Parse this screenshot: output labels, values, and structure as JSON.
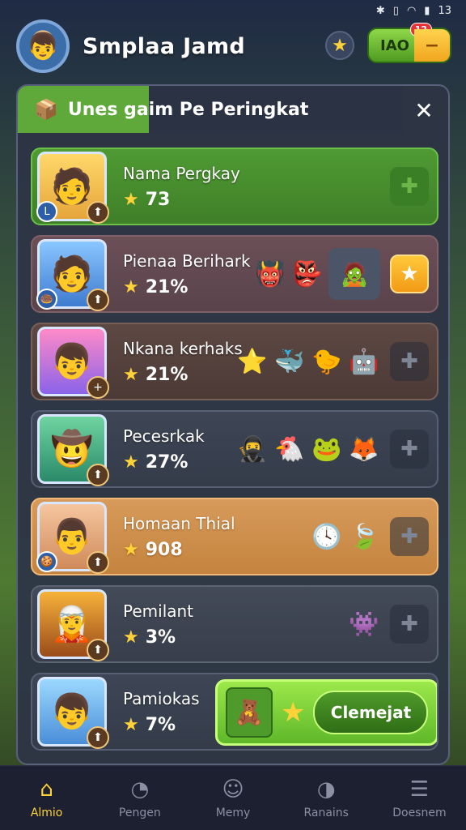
{
  "status_bar": {
    "icons": [
      "bluetooth-icon",
      "vibrate-icon",
      "wifi-icon",
      "signal-icon"
    ],
    "time": "13"
  },
  "header": {
    "title": "Smplaa Jamd",
    "avatar_icon": "👦",
    "star_icon": "★",
    "currency_value": "IAO",
    "currency_badge": "12",
    "currency_plus": "−"
  },
  "banner": {
    "icon": "📦",
    "text": "Unes gaim Pe Peringkat",
    "close": "✕"
  },
  "rows": [
    {
      "name": "Nama Pergkay",
      "score": "73",
      "avatar": "🧑",
      "badge": "⬆",
      "left_badge": "L"
    },
    {
      "name": "Pienaa Berihark",
      "score": "21%",
      "avatar": "🧑",
      "badge": "⬆",
      "left_badge": "🍩"
    },
    {
      "name": "Nkana kerhaks",
      "score": "21%",
      "avatar": "👦",
      "badge": "+"
    },
    {
      "name": "Pecesrkak",
      "score": "27%",
      "avatar": "🤠",
      "badge": "⬆"
    },
    {
      "name": "Homaan Thial",
      "score": "908",
      "avatar": "👨",
      "badge": "⬆",
      "left_badge": "🍪"
    },
    {
      "name": "Pemilant",
      "score": "3%",
      "avatar": "🧝",
      "badge": "⬆"
    },
    {
      "name": "Pamiokas",
      "score": "7%",
      "avatar": "👦",
      "badge": "⬆"
    }
  ],
  "claim": {
    "label": "Clemejat",
    "tile_icon": "🧸",
    "star": "★"
  },
  "nav": [
    {
      "label": "Almio",
      "icon": "⌂"
    },
    {
      "label": "Pengen",
      "icon": "◔"
    },
    {
      "label": "Memy",
      "icon": "☺"
    },
    {
      "label": "Ranains",
      "icon": "◑"
    },
    {
      "label": "Doesnem",
      "icon": "☰"
    }
  ],
  "colors": {
    "accent": "#ffd23a",
    "green": "#5ea93a",
    "panel": "#2e3546"
  }
}
